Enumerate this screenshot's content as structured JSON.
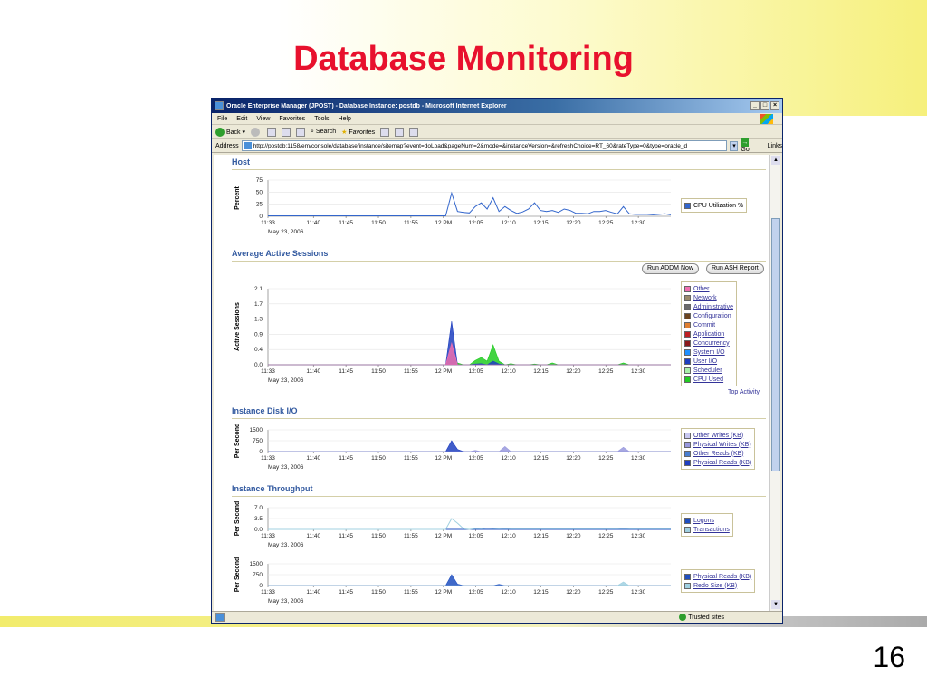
{
  "slide": {
    "title": "Database Monitoring",
    "page_number": "16"
  },
  "window": {
    "title": "Oracle Enterprise Manager (JPOST) - Database Instance: postdb - Microsoft Internet Explorer",
    "menu": [
      "File",
      "Edit",
      "View",
      "Favorites",
      "Tools",
      "Help"
    ],
    "toolbar": {
      "back": "Back",
      "search": "Search",
      "favorites": "Favorites"
    },
    "address_label": "Address",
    "address": "http://postdb:1158/em/console/database/instance/sitemap?event=doLoad&pageNum=2&mode=&instanceVersion=&refreshChoice=RT_60&rateType=0&type=oracle_d",
    "go": "Go",
    "links": "Links",
    "status_zone": "Trusted sites"
  },
  "x_ticks": [
    "11:33",
    "11:40",
    "11:45",
    "11:50",
    "11:55",
    "12 PM",
    "12:05",
    "12:10",
    "12:15",
    "12:20",
    "12:25",
    "12:30"
  ],
  "date_label": "May 23, 2006",
  "sections": {
    "host": {
      "title": "Host",
      "ylabel": "Percent",
      "yticks": [
        "75",
        "50",
        "25",
        "0"
      ],
      "legend": [
        {
          "label": "CPU Utilization %",
          "color": "#3366cc",
          "link": false
        }
      ]
    },
    "sessions": {
      "title": "Average Active Sessions",
      "ylabel": "Active Sessions",
      "yticks": [
        "2.1",
        "1.7",
        "1.3",
        "0.9",
        "0.4",
        "0.0"
      ],
      "buttons": {
        "addm": "Run ADDM Now",
        "ash": "Run ASH Report"
      },
      "link": "Top Activity",
      "legend": [
        {
          "label": "Other",
          "color": "#f06fb0",
          "link": true
        },
        {
          "label": "Network",
          "color": "#9b8a6b",
          "link": true
        },
        {
          "label": "Administrative",
          "color": "#6b6b6b",
          "link": true
        },
        {
          "label": "Configuration",
          "color": "#6b4420",
          "link": true
        },
        {
          "label": "Commit",
          "color": "#e08030",
          "link": true
        },
        {
          "label": "Application",
          "color": "#c02020",
          "link": true
        },
        {
          "label": "Concurrency",
          "color": "#8b1a1a",
          "link": true
        },
        {
          "label": "System I/O",
          "color": "#1e90ff",
          "link": true
        },
        {
          "label": "User I/O",
          "color": "#1f3fc0",
          "link": true
        },
        {
          "label": "Scheduler",
          "color": "#a8f0a8",
          "link": true
        },
        {
          "label": "CPU Used",
          "color": "#22cc22",
          "link": true
        }
      ]
    },
    "disk": {
      "title": "Instance Disk I/O",
      "ylabel": "Per Second",
      "yticks": [
        "1500",
        "750",
        "0"
      ],
      "legend": [
        {
          "label": "Other Writes (KB)",
          "color": "#c8c8f0",
          "link": true
        },
        {
          "label": "Physical Writes (KB)",
          "color": "#9999dd",
          "link": true
        },
        {
          "label": "Other Reads (KB)",
          "color": "#4a7fd0",
          "link": true
        },
        {
          "label": "Physical Reads (KB)",
          "color": "#1f3fc0",
          "link": true
        }
      ]
    },
    "throughput": {
      "title": "Instance Throughput",
      "ylabel": "Per Second",
      "yticks": [
        "7.0",
        "3.5",
        "0.0"
      ],
      "legend": [
        {
          "label": "Logons",
          "color": "#1f4fc0",
          "link": true
        },
        {
          "label": "Transactions",
          "color": "#a0d0e0",
          "link": true
        }
      ]
    },
    "throughput2": {
      "ylabel": "Per Second",
      "yticks": [
        "1500",
        "750",
        "0"
      ],
      "legend": [
        {
          "label": "Physical Reads (KB)",
          "color": "#1f4fc0",
          "link": true
        },
        {
          "label": "Redo Size (KB)",
          "color": "#a0d0e0",
          "link": true
        }
      ]
    }
  },
  "chart_data": [
    {
      "type": "line",
      "title": "Host",
      "ylabel": "Percent",
      "ylim": [
        0,
        75
      ],
      "series": [
        {
          "name": "CPU Utilization %",
          "values": [
            1,
            1,
            1,
            1,
            1,
            1,
            1,
            1,
            1,
            1,
            1,
            1,
            1,
            1,
            1,
            1,
            1,
            1,
            1,
            1,
            1,
            1,
            1,
            1,
            1,
            1,
            1,
            1,
            1,
            1,
            1,
            48,
            10,
            8,
            7,
            20,
            28,
            15,
            38,
            10,
            20,
            12,
            6,
            9,
            15,
            28,
            12,
            10,
            12,
            8,
            15,
            12,
            6,
            6,
            5,
            10,
            10,
            12,
            8,
            5,
            20,
            5,
            4,
            4,
            4,
            3,
            4,
            5,
            3
          ]
        }
      ]
    },
    {
      "type": "area",
      "title": "Average Active Sessions",
      "ylabel": "Active Sessions",
      "ylim": [
        0,
        2.1
      ],
      "series": [
        {
          "name": "CPU Used",
          "values": [
            0,
            0,
            0,
            0,
            0,
            0,
            0,
            0,
            0,
            0,
            0,
            0,
            0,
            0,
            0,
            0,
            0,
            0,
            0,
            0,
            0,
            0,
            0,
            0,
            0,
            0,
            0,
            0,
            0,
            0,
            0,
            0.3,
            0.05,
            0,
            0,
            0.12,
            0.2,
            0.1,
            0.55,
            0.1,
            0,
            0.03,
            0,
            0,
            0,
            0.02,
            0,
            0,
            0.05,
            0,
            0,
            0,
            0,
            0,
            0,
            0,
            0,
            0,
            0,
            0,
            0.05,
            0,
            0,
            0,
            0,
            0,
            0,
            0,
            0
          ]
        },
        {
          "name": "User I/O",
          "values": [
            0,
            0,
            0,
            0,
            0,
            0,
            0,
            0,
            0,
            0,
            0,
            0,
            0,
            0,
            0,
            0,
            0,
            0,
            0,
            0,
            0,
            0,
            0,
            0,
            0,
            0,
            0,
            0,
            0,
            0,
            0,
            1.2,
            0,
            0,
            0,
            0.02,
            0.03,
            0,
            0.1,
            0.02,
            0,
            0,
            0,
            0,
            0,
            0,
            0,
            0,
            0,
            0,
            0,
            0,
            0,
            0,
            0,
            0,
            0,
            0,
            0,
            0,
            0,
            0,
            0,
            0,
            0,
            0,
            0,
            0,
            0
          ]
        },
        {
          "name": "Other",
          "values": [
            0,
            0,
            0,
            0,
            0,
            0,
            0,
            0,
            0,
            0,
            0,
            0,
            0,
            0,
            0,
            0,
            0,
            0,
            0,
            0,
            0,
            0,
            0,
            0,
            0,
            0,
            0,
            0,
            0,
            0,
            0,
            0.6,
            0,
            0,
            0,
            0,
            0,
            0,
            0,
            0,
            0,
            0,
            0,
            0,
            0,
            0,
            0,
            0,
            0,
            0,
            0,
            0,
            0,
            0,
            0,
            0,
            0,
            0,
            0,
            0,
            0,
            0,
            0,
            0,
            0,
            0,
            0,
            0,
            0
          ]
        }
      ]
    },
    {
      "type": "area",
      "title": "Instance Disk I/O",
      "ylabel": "Per Second",
      "ylim": [
        0,
        1500
      ],
      "series": [
        {
          "name": "Physical Reads (KB)",
          "values": [
            0,
            0,
            0,
            0,
            0,
            0,
            0,
            0,
            0,
            0,
            0,
            0,
            0,
            0,
            0,
            0,
            0,
            0,
            0,
            0,
            0,
            0,
            0,
            0,
            0,
            0,
            0,
            0,
            0,
            0,
            0,
            750,
            150,
            0,
            0,
            0,
            0,
            0,
            0,
            0,
            0,
            0,
            0,
            0,
            0,
            0,
            0,
            0,
            0,
            0,
            0,
            0,
            0,
            0,
            0,
            0,
            0,
            0,
            0,
            0,
            0,
            0,
            0,
            0,
            0,
            0,
            0,
            0,
            0
          ]
        },
        {
          "name": "Physical Writes (KB)",
          "values": [
            0,
            0,
            0,
            0,
            0,
            0,
            0,
            0,
            0,
            0,
            0,
            0,
            0,
            0,
            0,
            0,
            0,
            0,
            0,
            0,
            0,
            0,
            0,
            0,
            0,
            0,
            0,
            0,
            0,
            0,
            0,
            0,
            0,
            0,
            0,
            80,
            0,
            0,
            0,
            0,
            350,
            0,
            0,
            0,
            0,
            0,
            0,
            0,
            0,
            0,
            0,
            0,
            0,
            0,
            0,
            0,
            0,
            0,
            0,
            0,
            300,
            0,
            0,
            0,
            0,
            0,
            0,
            0,
            0
          ]
        }
      ]
    },
    {
      "type": "line",
      "title": "Instance Throughput",
      "ylabel": "Per Second",
      "ylim": [
        0,
        7
      ],
      "series": [
        {
          "name": "Logons",
          "values": [
            0,
            0,
            0,
            0,
            0,
            0,
            0,
            0,
            0,
            0,
            0,
            0,
            0,
            0,
            0,
            0,
            0,
            0,
            0,
            0,
            0,
            0,
            0,
            0,
            0,
            0,
            0,
            0,
            0,
            0,
            0,
            0,
            0,
            0,
            0,
            0,
            0,
            0,
            0,
            0,
            0,
            0,
            0,
            0,
            0,
            0,
            0,
            0,
            0,
            0,
            0,
            0,
            0,
            0,
            0,
            0,
            0,
            0,
            0,
            0,
            0,
            0,
            0,
            0,
            0,
            0,
            0,
            0,
            0
          ]
        },
        {
          "name": "Transactions",
          "values": [
            0,
            0,
            0,
            0,
            0,
            0,
            0,
            0,
            0,
            0,
            0,
            0,
            0,
            0,
            0,
            0,
            0,
            0,
            0,
            0,
            0,
            0,
            0,
            0,
            0,
            0,
            0,
            0,
            0,
            0,
            0,
            3.5,
            2,
            0.2,
            0,
            0.3,
            0.2,
            0.4,
            0.3,
            0.2,
            0.3,
            0.2,
            0.2,
            0.2,
            0.2,
            0.2,
            0.2,
            0.2,
            0.2,
            0.2,
            0.2,
            0.2,
            0.2,
            0.2,
            0.2,
            0.2,
            0.2,
            0.2,
            0.2,
            0.2,
            0.3,
            0.2,
            0.2,
            0.2,
            0.2,
            0.2,
            0.2,
            0.2,
            0.2
          ]
        }
      ]
    },
    {
      "type": "area",
      "ylabel": "Per Second",
      "ylim": [
        0,
        1500
      ],
      "series": [
        {
          "name": "Physical Reads (KB)",
          "values": [
            0,
            0,
            0,
            0,
            0,
            0,
            0,
            0,
            0,
            0,
            0,
            0,
            0,
            0,
            0,
            0,
            0,
            0,
            0,
            0,
            0,
            0,
            0,
            0,
            0,
            0,
            0,
            0,
            0,
            0,
            0,
            750,
            100,
            0,
            0,
            0,
            0,
            0,
            0,
            80,
            0,
            0,
            0,
            0,
            0,
            0,
            0,
            0,
            0,
            0,
            0,
            0,
            0,
            0,
            0,
            0,
            0,
            0,
            0,
            0,
            0,
            0,
            0,
            0,
            0,
            0,
            0,
            0,
            0
          ]
        },
        {
          "name": "Redo Size (KB)",
          "values": [
            0,
            0,
            0,
            0,
            0,
            0,
            0,
            0,
            0,
            0,
            0,
            0,
            0,
            0,
            0,
            0,
            0,
            0,
            0,
            0,
            0,
            0,
            0,
            0,
            0,
            0,
            0,
            0,
            0,
            0,
            0,
            0,
            0,
            0,
            0,
            0,
            0,
            0,
            0,
            0,
            0,
            0,
            0,
            0,
            0,
            0,
            0,
            0,
            0,
            0,
            0,
            0,
            0,
            0,
            0,
            0,
            0,
            0,
            0,
            0,
            250,
            0,
            0,
            0,
            0,
            0,
            0,
            0,
            0
          ]
        }
      ]
    }
  ]
}
